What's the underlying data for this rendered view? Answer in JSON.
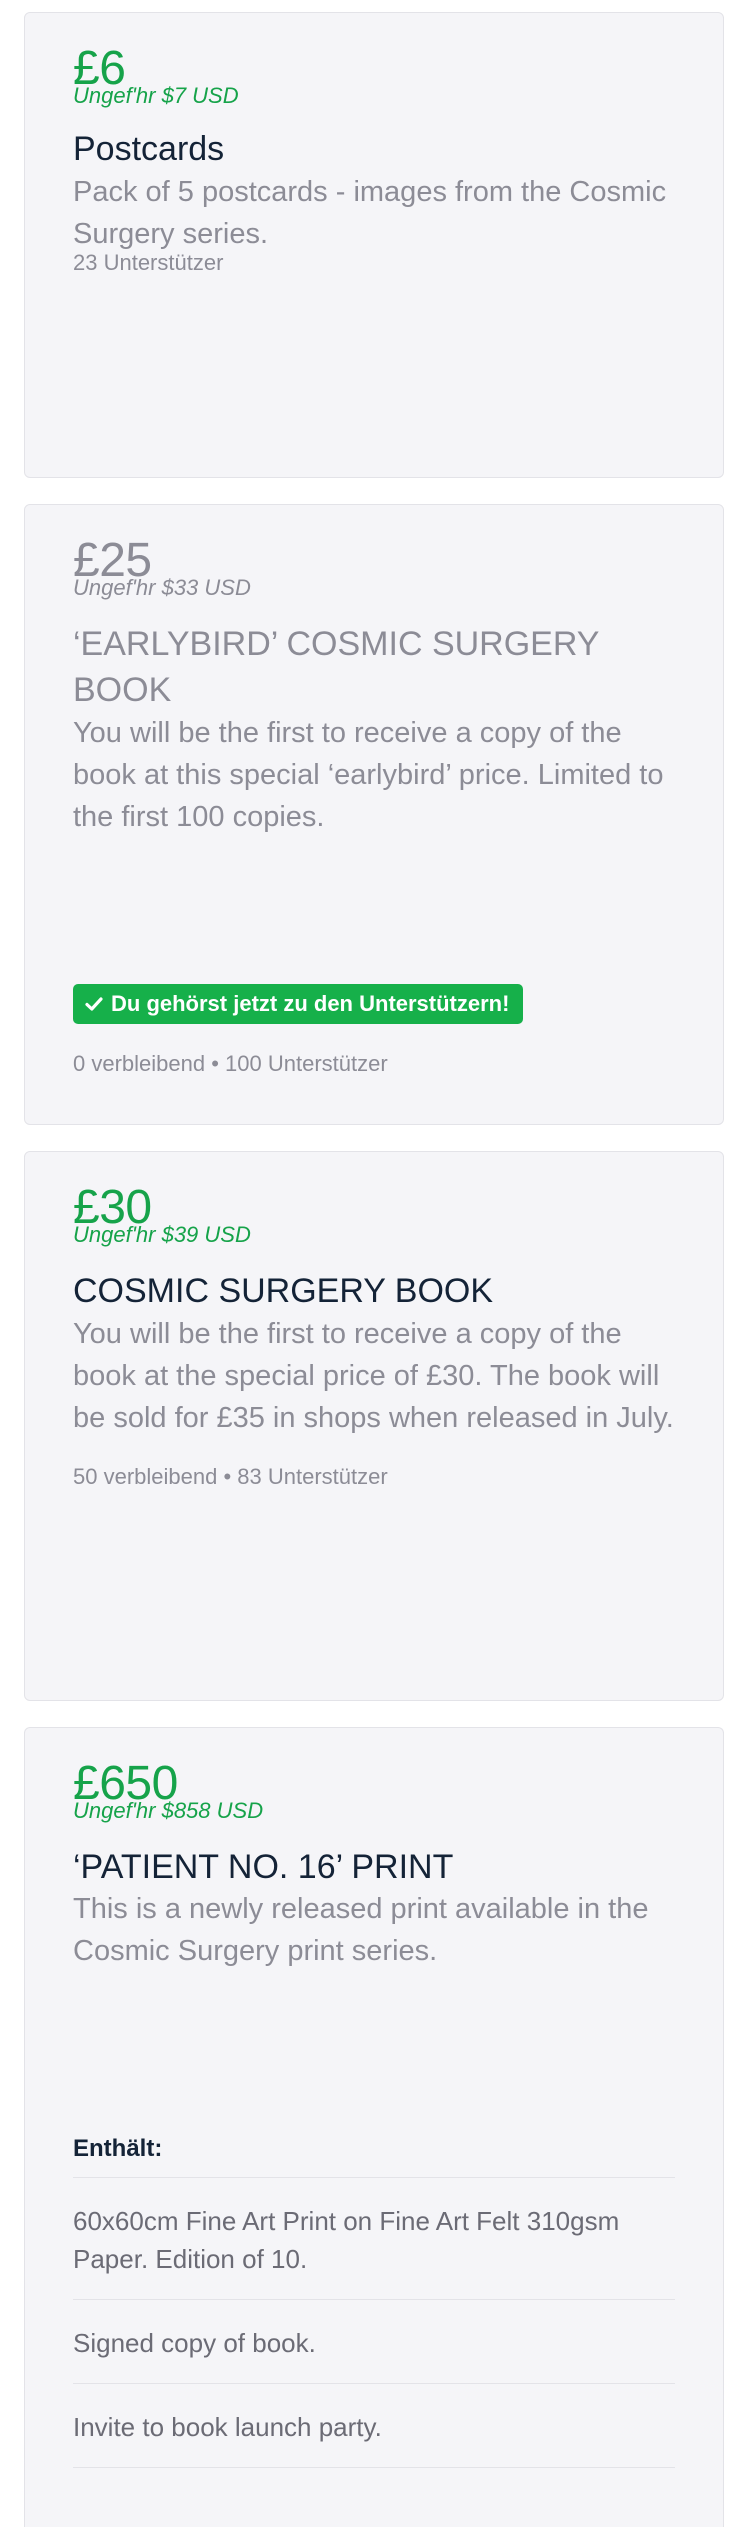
{
  "rewards": [
    {
      "price": "£6",
      "approx": "Ungef'hr $7 USD",
      "title": "Postcards",
      "description": "Pack of 5 postcards - images from the Cosmic Surgery series.",
      "backers": "23 Unterstützer"
    },
    {
      "price": "£25",
      "approx": "Ungef'hr $33 USD",
      "title": "‘EARLYBIRD’ COSMIC SURGERY BOOK",
      "description": "You will be the first to receive a copy of the book at this special ‘earlybird’ price. Limited to the first 100 copies.",
      "badge": "Du gehörst jetzt zu den Unterstützern!",
      "status": "0 verbleibend • 100 Unterstützer"
    },
    {
      "price": "£30",
      "approx": "Ungef'hr $39 USD",
      "title": "COSMIC SURGERY BOOK",
      "description": "You will be the first to receive a copy of the book at the special price of £30. The book will be sold for £35 in shops when released in July.",
      "status": "50 verbleibend • 83 Unterstützer"
    },
    {
      "price": "£650",
      "approx": "Ungef'hr $858 USD",
      "title": "‘PATIENT NO. 16’ PRINT",
      "description": "This is a newly released print available in the Cosmic Surgery print series.",
      "includes_label": "Enthält:",
      "includes": [
        "60x60cm Fine Art Print on Fine Art Felt 310gsm Paper. Edition of 10.",
        "Signed copy of book.",
        "Invite to book launch party."
      ]
    }
  ],
  "colors": {
    "accent": "#16a34a",
    "muted": "#8c8c96",
    "heading": "#142337",
    "card_bg": "#f5f5f8"
  },
  "icons": {
    "badge": "checkmark-icon"
  }
}
